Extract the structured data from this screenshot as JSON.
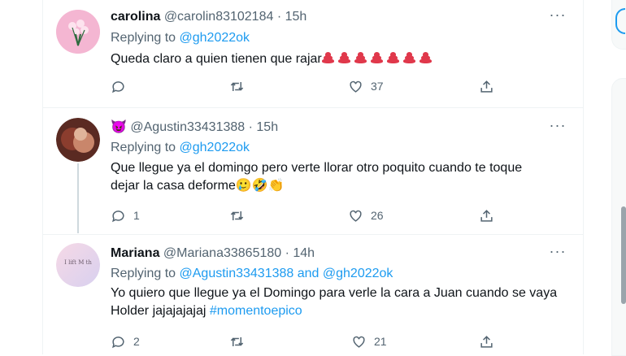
{
  "tweets": [
    {
      "name": "carolina",
      "handle": "@carolin83102184",
      "time": "· 15h",
      "replying_prefix": "Replying to",
      "replying_to": "@gh2022ok",
      "text": "Queda claro a quien tienen que rajar",
      "emojis": [
        "poop",
        "poop",
        "poop",
        "poop",
        "poop",
        "poop",
        "poop"
      ],
      "replies": "",
      "retweets": "",
      "likes": "37"
    },
    {
      "name": "😈",
      "handle": "@Agustin33431388",
      "time": "· 15h",
      "replying_prefix": "Replying to",
      "replying_to": "@gh2022ok",
      "text_line1": "Que llegue ya el domingo pero verte llorar otro poquito cuando te toque",
      "text_line2": "dejar la casa deforme",
      "emojis": [
        "🥲",
        "🤣",
        "👏"
      ],
      "replies": "1",
      "retweets": "",
      "likes": "26"
    },
    {
      "name": "Mariana",
      "handle": "@Mariana33865180",
      "time": "· 14h",
      "replying_prefix": "Replying to",
      "replying_to": "@Agustin33431388 and @gh2022ok",
      "text_line1": "Yo quiero que llegue ya el Domingo para verle la cara a Juan cuando se vaya",
      "text_line2": "Holder jajajajajaj",
      "hashtag": "#momentoepico",
      "avatar_text": "I  lift  M  th",
      "replies": "2",
      "retweets": "",
      "likes": "21"
    }
  ],
  "more_label": "···",
  "icons": [
    "reply-icon",
    "retweet-icon",
    "like-icon",
    "share-icon",
    "more-icon"
  ],
  "colors": {
    "accent": "#1d9bf0",
    "muted": "#536471",
    "text": "#0f1419",
    "border": "#eff3f4"
  }
}
